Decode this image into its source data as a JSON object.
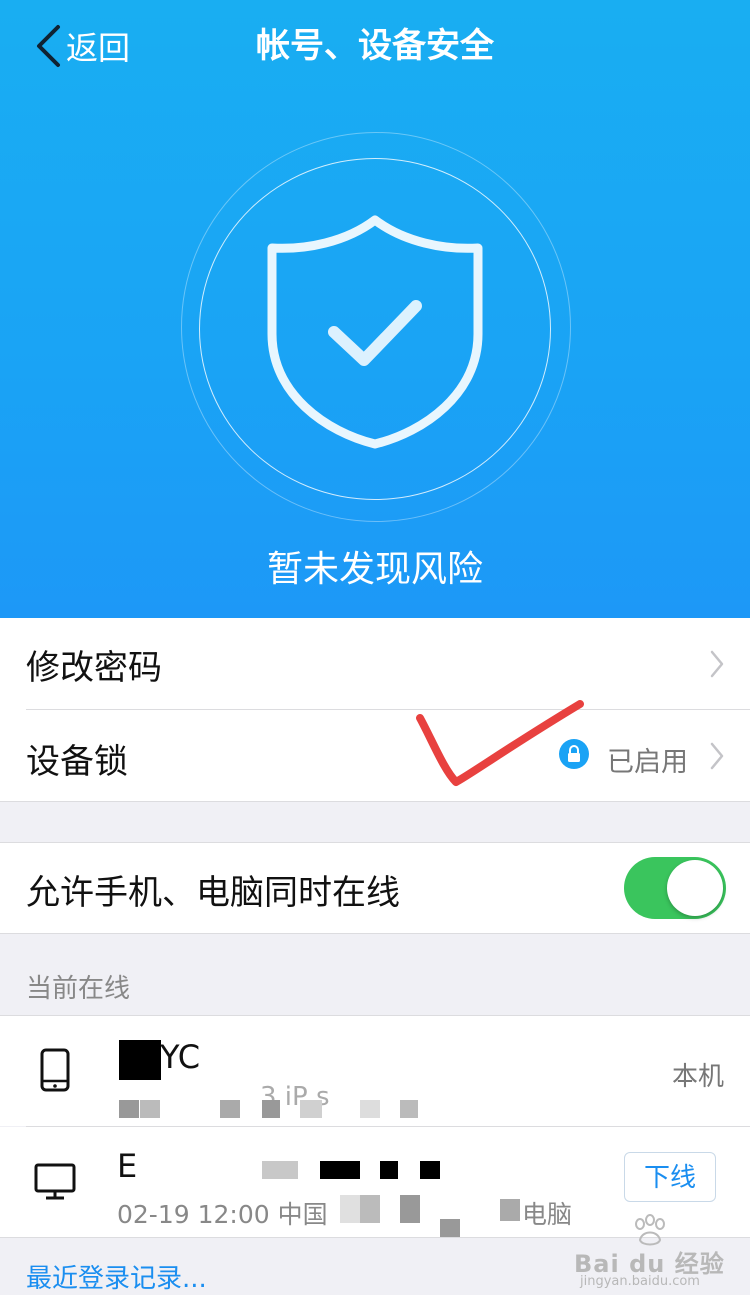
{
  "header": {
    "back_label": "返回",
    "title": "帐号、设备安全"
  },
  "hero": {
    "status": "暂未发现风险"
  },
  "settings": {
    "change_password": "修改密码",
    "device_lock": "设备锁",
    "device_lock_status": "已启用",
    "allow_simultaneous": "允许手机、电脑同时在线",
    "allow_simultaneous_on": true
  },
  "online": {
    "section_title": "当前在线",
    "devices": [
      {
        "name": "YC",
        "detail": "3 iP s",
        "tag": "本机",
        "icon": "phone-icon"
      },
      {
        "name": "E",
        "detail_date": "02-19 12:00 中国",
        "detail_suffix": "电脑",
        "action": "下线",
        "icon": "monitor-icon"
      }
    ]
  },
  "recent_login_link": "最近登录记录...",
  "watermark": {
    "brand": "Bai du 经验",
    "url": "jingyan.baidu.com"
  },
  "colors": {
    "hero": "#1aa3f5",
    "toggle_on": "#3ac55d",
    "link": "#1a8ef0",
    "annotation": "#e8413f"
  }
}
